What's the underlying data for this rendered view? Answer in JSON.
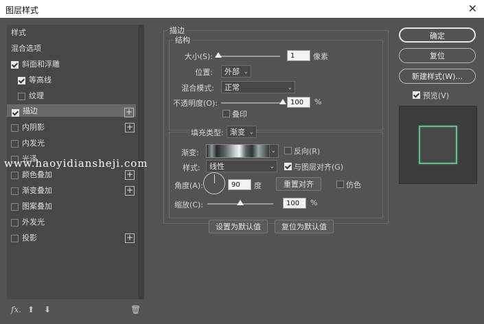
{
  "window": {
    "title": "图层样式",
    "close_glyph": "✕"
  },
  "styles_panel": {
    "items": [
      {
        "label": "样式",
        "checkbox": null,
        "checked": false,
        "plus": false,
        "selected": false,
        "indent": 0
      },
      {
        "label": "混合选项",
        "checkbox": null,
        "checked": false,
        "plus": false,
        "selected": false,
        "indent": 0
      },
      {
        "label": "斜面和浮雕",
        "checkbox": true,
        "checked": true,
        "plus": false,
        "selected": false,
        "indent": 0
      },
      {
        "label": "等高线",
        "checkbox": true,
        "checked": true,
        "plus": false,
        "selected": false,
        "indent": 1
      },
      {
        "label": "纹理",
        "checkbox": true,
        "checked": false,
        "plus": false,
        "selected": false,
        "indent": 1
      },
      {
        "label": "描边",
        "checkbox": true,
        "checked": true,
        "plus": true,
        "selected": true,
        "indent": 0
      },
      {
        "label": "内阴影",
        "checkbox": true,
        "checked": false,
        "plus": true,
        "selected": false,
        "indent": 0
      },
      {
        "label": "内发光",
        "checkbox": true,
        "checked": false,
        "plus": false,
        "selected": false,
        "indent": 0
      },
      {
        "label": "光泽",
        "checkbox": true,
        "checked": false,
        "plus": false,
        "selected": false,
        "indent": 0
      },
      {
        "label": "颜色叠加",
        "checkbox": true,
        "checked": false,
        "plus": true,
        "selected": false,
        "indent": 0
      },
      {
        "label": "渐变叠加",
        "checkbox": true,
        "checked": false,
        "plus": true,
        "selected": false,
        "indent": 0
      },
      {
        "label": "图案叠加",
        "checkbox": true,
        "checked": false,
        "plus": false,
        "selected": false,
        "indent": 0
      },
      {
        "label": "外发光",
        "checkbox": true,
        "checked": false,
        "plus": false,
        "selected": false,
        "indent": 0
      },
      {
        "label": "投影",
        "checkbox": true,
        "checked": false,
        "plus": true,
        "selected": false,
        "indent": 0
      }
    ],
    "bottom_icons": {
      "fx": "fx.",
      "up": "⬆",
      "down": "⬇",
      "trash": "🗑"
    }
  },
  "stroke": {
    "section_title": "描边",
    "structure": {
      "title": "结构",
      "size_label": "大小(S):",
      "size_value": "1",
      "size_unit": "像素",
      "position_label": "位置:",
      "position_value": "外部",
      "blend_label": "混合模式:",
      "blend_value": "正常",
      "opacity_label": "不透明度(O):",
      "opacity_value": "100",
      "opacity_unit": "%",
      "overprint_label": "叠印"
    },
    "fill": {
      "fill_type_label": "填充类型:",
      "fill_type_value": "渐变",
      "gradient_label": "渐变:",
      "reverse_label": "反向(R)",
      "style_label": "样式:",
      "style_value": "线性",
      "align_label": "与图层对齐(G)",
      "angle_label": "角度(A):",
      "angle_value": "90",
      "angle_unit": "度",
      "reset_align_label": "重置对齐",
      "dither_label": "仿色",
      "scale_label": "缩放(C):",
      "scale_value": "100",
      "scale_unit": "%"
    },
    "set_default_label": "设置为默认值",
    "reset_default_label": "复位为默认值"
  },
  "actions": {
    "ok": "确定",
    "reset": "复位",
    "new_style": "新建样式(W)...",
    "preview_label": "预览(V)"
  },
  "controls": {
    "size_slider_fraction": 0.0,
    "opacity_slider_fraction": 1.0,
    "scale_slider_fraction": 0.5,
    "reverse_checked": false,
    "align_checked": true,
    "dither_checked": false,
    "overprint_checked": false,
    "preview_checked": true
  },
  "watermark": {
    "text": "www.haoyidiansheji.com"
  },
  "colors": {
    "dialog_bg": "#535353",
    "panel_bg": "#474747",
    "selected_row": "#686868",
    "preview_stroke": "#5fbf8f"
  }
}
